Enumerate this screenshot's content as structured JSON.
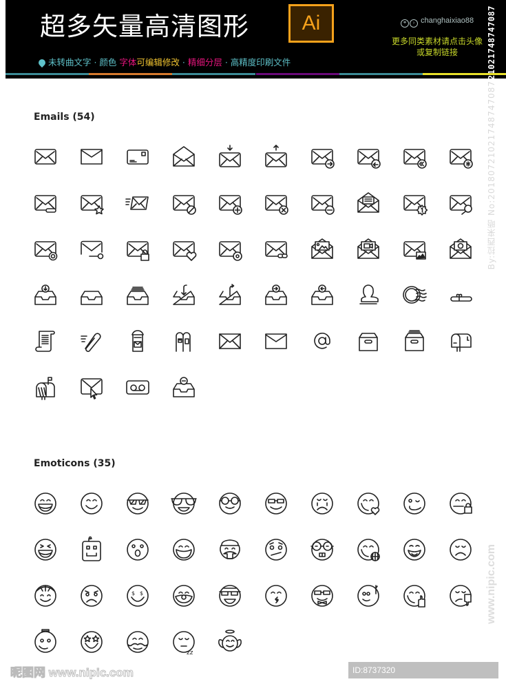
{
  "banner": {
    "title": "超多矢量高清图形",
    "logo_text": "Ai",
    "features": [
      {
        "text": "未转曲文字",
        "color": "#5ec1c9"
      },
      {
        "text": " · ",
        "color": "#5ec1c9"
      },
      {
        "text": "颜色 ",
        "color": "#5ec1c9"
      },
      {
        "text": "字体",
        "color": "#e6157d"
      },
      {
        "text": "可编辑修改",
        "color": "#f2c531"
      },
      {
        "text": " · ",
        "color": "#5ec1c9"
      },
      {
        "text": "精细分层",
        "color": "#e6157d"
      },
      {
        "text": " · ",
        "color": "#5ec1c9"
      },
      {
        "text": "高精度印刷文件",
        "color": "#5ec1c9"
      }
    ],
    "author": "changhaixiao88",
    "promo_line1": "更多同类素材请点击头像",
    "promo_line2": "或复制链接",
    "stripe_colors": [
      "#3c8b96",
      "#d77a2e",
      "#3c8b96",
      "#6a0a7a",
      "#3c8b96",
      "#e9e12a"
    ]
  },
  "watermarks": {
    "vertical_id": "ID:8737320 NO:20180721021748747087",
    "vertical_by": "By:拉西来晤 No:20180721021748747087",
    "vertical_site": "www.nipic.com",
    "footer_logo": "昵图网 www.nipic.com",
    "footer_id": "ID:8737320 NO:20180721021748747087"
  },
  "sections": {
    "emails": {
      "title": "Emails (54)",
      "icons": [
        "envelope",
        "envelope-flat",
        "postcard",
        "envelope-open",
        "mail-download",
        "mail-upload",
        "mail-forward",
        "mail-reply",
        "mail-reply-all",
        "mail-starred",
        "mail-attachment",
        "mail-favorite",
        "mail-send-fast",
        "mail-blocked",
        "mail-add",
        "mail-delete",
        "mail-remove",
        "mail-open-letter",
        "mail-notification",
        "mail-search",
        "mail-settings",
        "mail-key",
        "mail-locked",
        "mail-love",
        "mail-at",
        "mail-link",
        "mail-photo",
        "mail-video",
        "mail-image",
        "mail-money",
        "inbox-download",
        "inbox-empty",
        "inbox-full",
        "inbox-in",
        "inbox-out",
        "inbox-forward",
        "inbox-reply",
        "stamp",
        "postmark",
        "scroll-ribbon",
        "scroll-letter",
        "mail-pin",
        "post-box",
        "mailbox-double",
        "envelope-cross",
        "envelope-plain",
        "at-sign",
        "archive-box",
        "archive-full",
        "mailbox",
        "mailbox-flag",
        "mail-cursor",
        "voicemail",
        "inbox-minus"
      ]
    },
    "emoticons": {
      "title": "Emoticons (35)",
      "icons": [
        "laughing",
        "smiling",
        "sunglasses-cool",
        "aviator-sunglasses",
        "round-glasses",
        "nerd-glasses",
        "crying",
        "kiss-heart",
        "winking",
        "zipped-mouth",
        "squinting-laugh",
        "robot",
        "surprised",
        "big-grin",
        "officer-mustache",
        "confused",
        "geek-teeth",
        "world-smile",
        "tongue-out",
        "sad",
        "cap-smile",
        "angry",
        "money-eyes",
        "clown",
        "cool-grin",
        "whistling",
        "bow-tie-nerd",
        "rocker",
        "thumbs-up",
        "thumbs-down",
        "punk-smile",
        "star-eyes",
        "mustache",
        "sleeping",
        "angel"
      ]
    }
  }
}
